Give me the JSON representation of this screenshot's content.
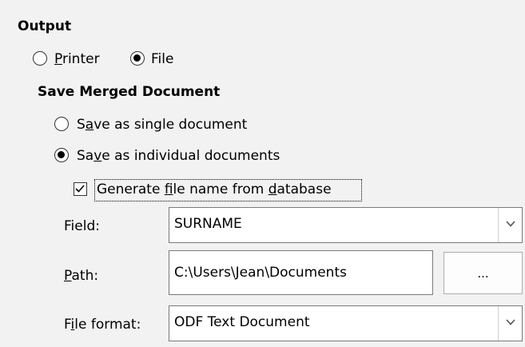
{
  "output": {
    "heading": "Output",
    "printer": {
      "label_pre": "",
      "label_u": "P",
      "label_post": "rinter",
      "checked": false
    },
    "file": {
      "label": "File",
      "checked": true
    }
  },
  "save_merged": {
    "heading": "Save Merged Document",
    "single": {
      "label_pre": "S",
      "label_u": "a",
      "label_post": "ve as single document",
      "checked": false
    },
    "individual": {
      "label_pre": "Sa",
      "label_u": "v",
      "label_post": "e as individual documents",
      "checked": true
    },
    "generate": {
      "label_pre": "Generate ",
      "label_u1": "f",
      "label_mid": "ile name from ",
      "label_u2": "d",
      "label_post": "atabase",
      "checked": true
    }
  },
  "field_row": {
    "label": "Field:",
    "value": "SURNAME"
  },
  "path_row": {
    "label_u": "P",
    "label_post": "ath:",
    "value": "C:\\Users\\Jean\\Documents",
    "browse_label": "..."
  },
  "format_row": {
    "label_pre": "F",
    "label_u": "i",
    "label_post": "le format:",
    "value": "ODF Text Document"
  }
}
